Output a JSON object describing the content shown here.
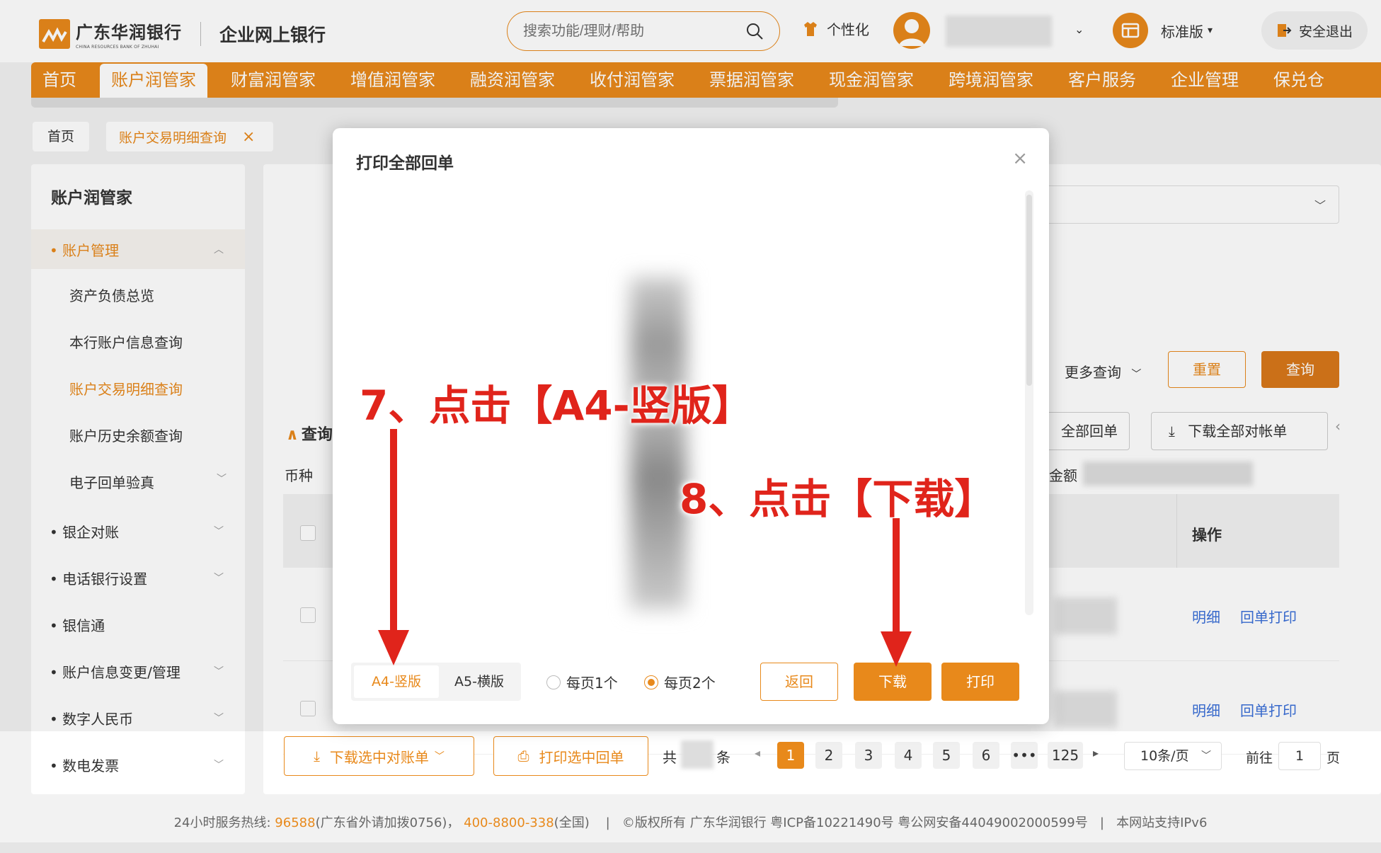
{
  "header": {
    "bank_name": "广东华润银行",
    "bank_name_en": "CHINA RESOURCES BANK OF ZHUHAI",
    "portal": "企业网上银行",
    "search_placeholder": "搜索功能/理财/帮助",
    "personalize": "个性化",
    "version": "标准版",
    "logout": "安全退出"
  },
  "nav": {
    "items": [
      "首页",
      "账户润管家",
      "财富润管家",
      "增值润管家",
      "融资润管家",
      "收付润管家",
      "票据润管家",
      "现金润管家",
      "跨境润管家",
      "客户服务",
      "企业管理",
      "保兑仓"
    ],
    "active_index": 1
  },
  "tabs": {
    "home": "首页",
    "current": "账户交易明细查询",
    "close": "×"
  },
  "sidebar": {
    "title": "账户润管家",
    "groups": [
      {
        "label": "• 账户管理",
        "active": true
      },
      {
        "label": "• 银企对账"
      },
      {
        "label": "• 电话银行设置"
      },
      {
        "label": "• 银信通"
      },
      {
        "label": "• 账户信息变更/管理"
      },
      {
        "label": "• 数字人民币"
      },
      {
        "label": "• 数电发票"
      }
    ],
    "subs": [
      {
        "label": "资产负债总览"
      },
      {
        "label": "本行账户信息查询"
      },
      {
        "label": "账户交易明细查询",
        "active": true
      },
      {
        "label": "账户历史余额查询"
      },
      {
        "label": "电子回单验真"
      }
    ]
  },
  "main": {
    "more_query": "更多查询",
    "reset": "重置",
    "query": "查询",
    "all_receipt": "全部回单",
    "download_all_statement": "下载全部对帐单",
    "query_title": "查询",
    "currency_label": "币种",
    "amount_label": "金额",
    "table": {
      "operation_header": "操作",
      "rows": [
        {
          "detail": "明细",
          "print": "回单打印"
        },
        {
          "detail": "明细",
          "print": "回单打印"
        }
      ]
    }
  },
  "pagination": {
    "download_selected": "下载选中对账单",
    "print_selected": "打印选中回单",
    "total_prefix": "共",
    "total_suffix": "条",
    "pages": [
      "1",
      "2",
      "3",
      "4",
      "5",
      "6",
      "•••",
      "125"
    ],
    "current_page": "1",
    "page_size": "10条/页",
    "goto_prefix": "前往",
    "goto_value": "1",
    "goto_suffix": "页"
  },
  "footer": {
    "hotline_label": "24小时服务热线:",
    "hotline1": "96588",
    "hotline1_note": "(广东省外请加拨0756)",
    "sep1": "，",
    "hotline2": "400-8800-338",
    "hotline2_note": "(全国)",
    "divider": "|",
    "copyright": "©版权所有  广东华润银行  粤ICP备10221490号  粤公网安备44049002000599号",
    "ipv6": "本网站支持IPv6"
  },
  "modal": {
    "title": "打印全部回单",
    "close": "×",
    "paper_a4": "A4-竖版",
    "paper_a5": "A5-横版",
    "per_page_1": "每页1个",
    "per_page_2": "每页2个",
    "per_page_selected": 2,
    "back": "返回",
    "download": "下载",
    "print": "打印"
  },
  "annotations": {
    "step7": "7、点击【A4-竖版】",
    "step8": "8、点击【下载】"
  },
  "colors": {
    "brand": "#e8891b",
    "annotation": "#e0241b",
    "link": "#3a6fd8"
  }
}
